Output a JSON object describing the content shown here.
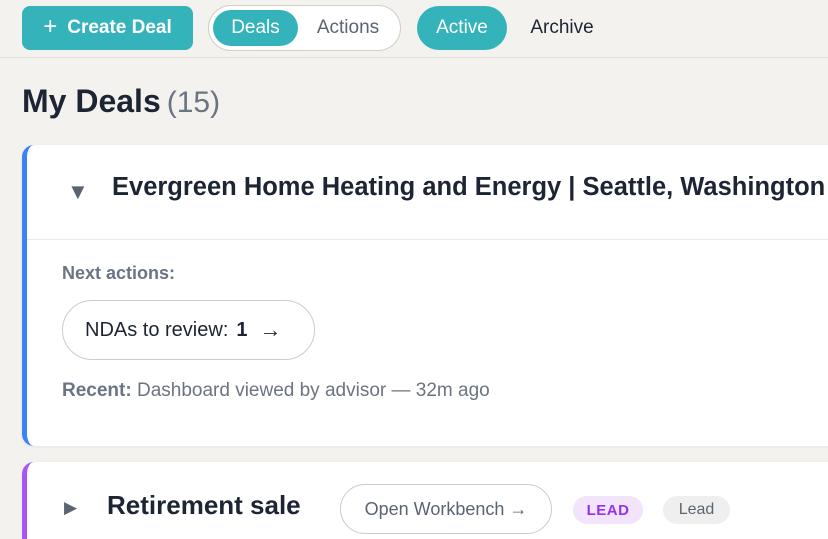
{
  "colors": {
    "accent": "#35b3bb",
    "deal1_stripe": "#3b82f6",
    "deal2_stripe": "#a855f7",
    "lead_badge_text": "#9333ea",
    "lead_badge_bg": "#f1e4fb"
  },
  "toolbar": {
    "create_icon": "plus-icon",
    "create_label": "Create Deal",
    "view_tabs": [
      {
        "label": "Deals",
        "selected": true
      },
      {
        "label": "Actions",
        "selected": false
      }
    ],
    "filter_tabs": [
      {
        "label": "Active",
        "selected": true
      },
      {
        "label": "Archive",
        "selected": false
      }
    ]
  },
  "page": {
    "title": "My Deals",
    "count": "(15)"
  },
  "deals": [
    {
      "expanded": true,
      "caret_icon": "caret-down-icon",
      "title": "Evergreen Home Heating and Energy | Seattle, Washington",
      "next_actions_label": "Next actions:",
      "nda_label": "NDAs to review:",
      "nda_count": "1",
      "nda_arrow": "→",
      "recent_label": "Recent:",
      "recent_text": "Dashboard viewed by advisor — 32m ago"
    },
    {
      "expanded": false,
      "caret_icon": "caret-right-icon",
      "title": "Retirement sale",
      "workbench_label": "Open Workbench →",
      "badge_stage": "LEAD",
      "badge_status": "Lead"
    }
  ]
}
